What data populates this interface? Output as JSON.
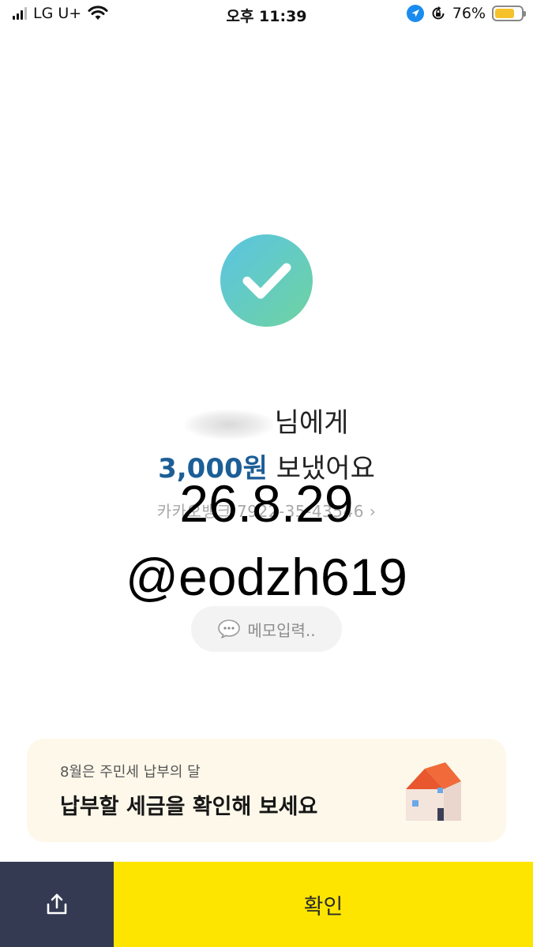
{
  "status_bar": {
    "carrier": "LG U+",
    "time": "오후 11:39",
    "battery_percent_text": "76%",
    "battery_level": 0.76,
    "icons": [
      "cellular-signal-icon",
      "wifi-icon",
      "location-arrow-icon",
      "rotation-lock-icon",
      "battery-icon"
    ]
  },
  "result": {
    "icon": "check-icon",
    "recipient_suffix": "님에게",
    "amount": "3,000원",
    "sent_text": "보냈어요",
    "account": "카카오뱅크 7922-35-43546",
    "overlay_line1": "26.8.29",
    "overlay_line2": "@eodzh619"
  },
  "memo": {
    "icon": "speech-bubble-icon",
    "placeholder": "메모입력.."
  },
  "banner": {
    "subtitle": "8월은 주민세 납부의 달",
    "title": "납부할 세금을 확인해 보세요",
    "icon": "house-icon"
  },
  "footer": {
    "share_icon": "share-icon",
    "confirm_label": "확인"
  },
  "colors": {
    "amount": "#1c5e96",
    "confirm_bg": "#fee500",
    "share_bg": "#333a52",
    "banner_bg": "#fdf8ea",
    "check_gradient": [
      "#5ac4e3",
      "#6fd3a0"
    ]
  }
}
